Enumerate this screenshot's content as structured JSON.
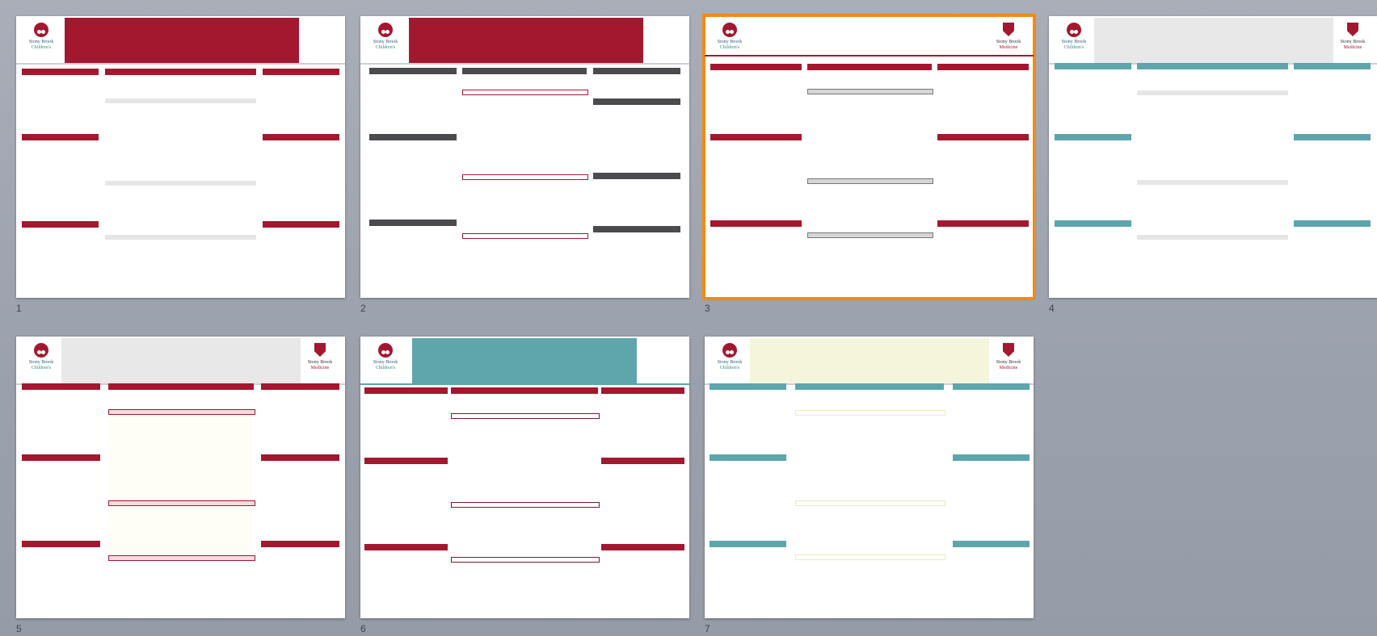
{
  "colors": {
    "brand_red": "#a3182f",
    "dark_gray": "#4a4a4f",
    "teal": "#5ea5ac",
    "pale_gray": "#e6e6e6",
    "cream": "#f5f5dc",
    "selection_orange": "#f28a17"
  },
  "logos": {
    "childrens_line1": "Stony Brook",
    "childrens_line2": "Children's",
    "medicine_line1": "Stony Brook",
    "medicine_line2": "Medicine"
  },
  "selected_slide": 3,
  "slides": [
    {
      "number": "1",
      "header_band": "red",
      "right_logo": false,
      "bar_style": "red",
      "center_style": "pale-gray"
    },
    {
      "number": "2",
      "header_band": "red",
      "right_logo": false,
      "bar_style": "dark",
      "center_style": "outline-red"
    },
    {
      "number": "3",
      "header_band": "none",
      "right_logo": true,
      "bar_style": "red",
      "center_style": "outline-gray"
    },
    {
      "number": "4",
      "header_band": "light-gray",
      "right_logo": true,
      "bar_style": "teal",
      "center_style": "pale-gray"
    },
    {
      "number": "5",
      "header_band": "light-gray",
      "right_logo": true,
      "bar_style": "red",
      "center_style": "outline-red-fill"
    },
    {
      "number": "6",
      "header_band": "teal",
      "right_logo": false,
      "bar_style": "red",
      "center_style": "outline-maroon"
    },
    {
      "number": "7",
      "header_band": "cream",
      "right_logo": true,
      "bar_style": "teal",
      "center_style": "outline-yellow"
    }
  ]
}
